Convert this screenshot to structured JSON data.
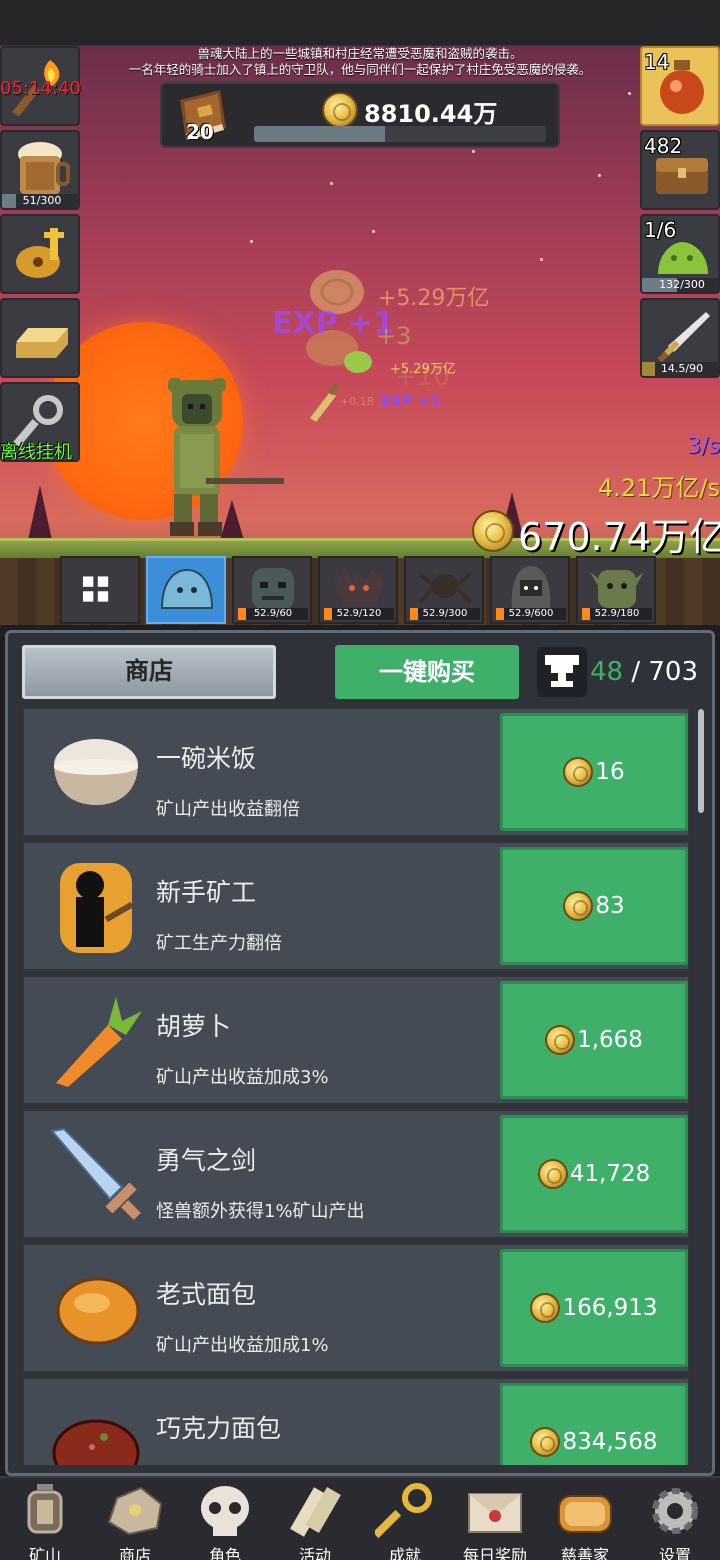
{
  "story": {
    "line1": "兽魂大陆上的一些城镇和村庄经常遭受恶魔和盗贼的袭击。",
    "line2": "一名年轻的骑士加入了镇上的守卫队，他与同伴们一起保护了村庄免受恶魔的侵袭。"
  },
  "top": {
    "book_count": "20",
    "gold": "8810.44万",
    "progress": 0.45
  },
  "left_slots": {
    "timer": "05:14:40",
    "drink_bar": "51/300",
    "drink_progress": 0.17,
    "offline_label": "离线挂机"
  },
  "right_slots": {
    "potion_count": "14",
    "chest_count": "482",
    "slime_count": "1/6",
    "slime_bar": "132/300",
    "slime_progress": 0.44,
    "sword_bar": "14.5/90",
    "sword_progress": 0.16
  },
  "effects": {
    "f1": "+5.29万亿",
    "f2": "+5.29万亿",
    "f3": "+0.18",
    "f4": "EXP +1",
    "f5": "EXP +1",
    "f6": "+3",
    "f7": "+10"
  },
  "rates": {
    "exp_rate": "3/s",
    "gold_rate": "4.21万亿/s",
    "total": "670.74万亿"
  },
  "monster_tabs": [
    {
      "label": "grid"
    },
    {
      "label": "slime",
      "bar": ""
    },
    {
      "label": "ghoul",
      "bar": "52.9/60"
    },
    {
      "label": "bat",
      "bar": "52.9/120"
    },
    {
      "label": "spider",
      "bar": "52.9/300"
    },
    {
      "label": "wraith",
      "bar": "52.9/600"
    },
    {
      "label": "orc",
      "bar": "52.9/180"
    }
  ],
  "shop": {
    "tab_label": "商店",
    "buy_all_label": "一键购买",
    "trophy_current": "48",
    "trophy_sep": " / ",
    "trophy_total": "703",
    "items": [
      {
        "name": "一碗米饭",
        "desc": "矿山产出收益翻倍",
        "price": "16"
      },
      {
        "name": "新手矿工",
        "desc": "矿工生产力翻倍",
        "price": "83"
      },
      {
        "name": "胡萝卜",
        "desc": "矿山产出收益加成3%",
        "price": "1,668"
      },
      {
        "name": "勇气之剑",
        "desc": "怪兽额外获得1%矿山产出",
        "price": "41,728"
      },
      {
        "name": "老式面包",
        "desc": "矿山产出收益加成1%",
        "price": "166,913"
      },
      {
        "name": "巧克力面包",
        "desc": "",
        "price": "834,568"
      }
    ]
  },
  "nav": [
    {
      "label": "矿山",
      "icon": "lantern-icon"
    },
    {
      "label": "商店",
      "icon": "ore-icon"
    },
    {
      "label": "角色",
      "icon": "skull-icon"
    },
    {
      "label": "活动",
      "icon": "scroll-icon"
    },
    {
      "label": "成就",
      "icon": "key-icon"
    },
    {
      "label": "每日奖励",
      "icon": "envelope-icon"
    },
    {
      "label": "慈善家",
      "icon": "bread-icon"
    },
    {
      "label": "设置",
      "icon": "gear-icon"
    }
  ],
  "colors": {
    "accent_green": "#3fb06a",
    "panel": "#2f3238",
    "row": "#454b54",
    "gold_text": "#ffd640",
    "exp_purple": "#9a5cff"
  }
}
